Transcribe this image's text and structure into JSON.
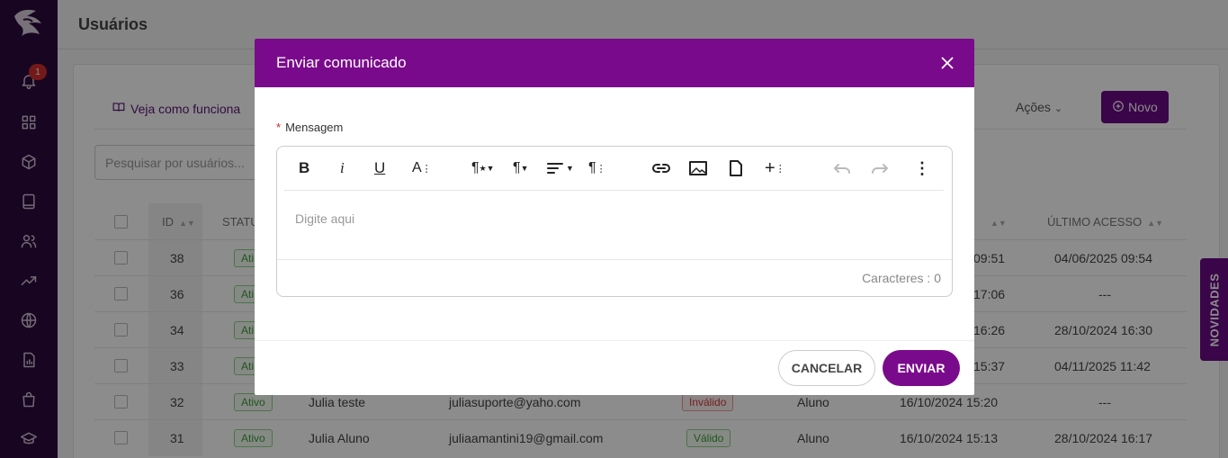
{
  "sidebar": {
    "notification_count": "1",
    "icons": [
      "bell-icon",
      "grid-icon",
      "cube-icon",
      "book-icon",
      "users-icon",
      "trend-icon",
      "globe-icon",
      "report-icon",
      "bag-icon",
      "graduation-icon"
    ]
  },
  "page": {
    "title": "Usuários",
    "how_it_works": "Veja como funciona",
    "actions_label": "Ações",
    "new_label": "Novo",
    "search_placeholder": "Pesquisar por usuários...",
    "columns": {
      "id": "ID",
      "status": "STATU",
      "last_access": "ÚLTIMO ACESSO"
    },
    "rows": [
      {
        "id": "38",
        "status": "Ati",
        "date1": "09:51",
        "last_access": "04/06/2025 09:54"
      },
      {
        "id": "36",
        "status": "Ati",
        "date1": "17:06",
        "last_access": "---"
      },
      {
        "id": "34",
        "status": "Ati",
        "date1": "16:26",
        "last_access": "28/10/2024 16:30"
      },
      {
        "id": "33",
        "status": "Ati",
        "date1": "15:37",
        "last_access": "04/11/2025 11:42"
      },
      {
        "id": "32",
        "status": "Ativo",
        "name": "Julia teste",
        "email": "juliasuporte@yaho.com",
        "email_status": "Inválido",
        "role": "Aluno",
        "date1": "16/10/2024 15:20",
        "last_access": "---"
      },
      {
        "id": "31",
        "status": "Ativo",
        "name": "Julia Aluno",
        "email": "juliaamantini19@gmail.com",
        "email_status": "Válido",
        "role": "Aluno",
        "date1": "16/10/2024 15:13",
        "last_access": "28/10/2024 16:17"
      }
    ],
    "news_tab": "NOVIDADES"
  },
  "modal": {
    "title": "Enviar comunicado",
    "field_label": "Mensagem",
    "placeholder": "Digite aqui",
    "char_count": "Caracteres : 0",
    "cancel_label": "CANCELAR",
    "send_label": "ENVIAR",
    "toolbar_icons": [
      "bold-icon",
      "italic-icon",
      "underline-icon",
      "font-size-icon",
      "paragraph-style-icon",
      "paragraph-icon",
      "align-icon",
      "paragraph-more-icon",
      "link-icon",
      "image-icon",
      "file-icon",
      "insert-more-icon",
      "undo-icon",
      "redo-icon",
      "more-vertical-icon"
    ]
  },
  "colors": {
    "brand": "#7a0a8c",
    "sidebar": "#2c0a3d",
    "valid": "#3e9b36",
    "invalid": "#d23b3b"
  }
}
